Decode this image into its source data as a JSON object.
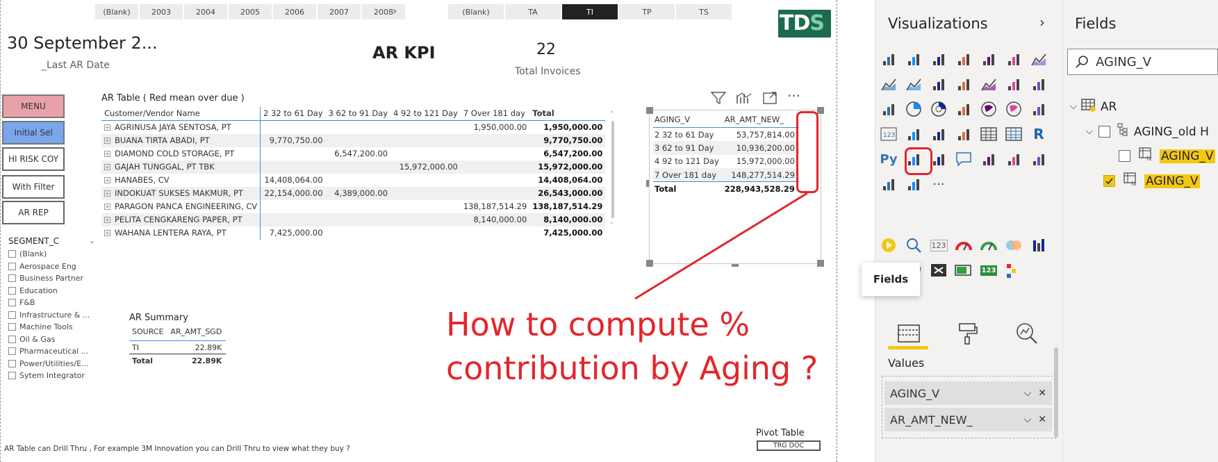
{
  "year_slicer": [
    "(Blank)",
    "2003",
    "2004",
    "2005",
    "2006",
    "2007",
    "2008"
  ],
  "segment_chips": [
    {
      "label": "(Blank)",
      "selected": false
    },
    {
      "label": "TA",
      "selected": false
    },
    {
      "label": "TI",
      "selected": true
    },
    {
      "label": "TP",
      "selected": false
    },
    {
      "label": "TS",
      "selected": false
    }
  ],
  "logo": {
    "text": "TDS"
  },
  "date_card": {
    "value": "30 September 2...",
    "label": "_Last AR Date"
  },
  "kpi_title": "AR KPI",
  "invoice_card": {
    "value": "22",
    "label": "Total Invoices"
  },
  "nav_buttons": {
    "menu": "MENU",
    "initial": "Initial Sel",
    "hi_risk": "HI RISK COY",
    "with_filter": "With Filter",
    "ar_rep": "AR REP"
  },
  "segment_slicer": {
    "title": "SEGMENT_C",
    "items": [
      "(Blank)",
      "Aerospace Eng",
      "Business Partner",
      "Education",
      "F&B",
      "Infrastructure & ...",
      "Machine Tools",
      "Oil & Gas",
      "Pharmaceutical ...",
      "Power/Utilities/E...",
      "Sytem Integrator"
    ]
  },
  "ar_table": {
    "title": "AR Table ( Red mean over due )",
    "columns": [
      "Customer/Vendor Name",
      "2 32 to 61 Day",
      "3 62 to 91 Day",
      "4 92 to 121 Day",
      "7 Over 181 day",
      "Total"
    ],
    "rows": [
      [
        "AGRINUSA JAYA SENTOSA, PT",
        "",
        "",
        "",
        "1,950,000.00",
        "1,950,000.00"
      ],
      [
        "BUANA TIRTA ABADI, PT",
        "9,770,750.00",
        "",
        "",
        "",
        "9,770,750.00"
      ],
      [
        "DIAMOND COLD STORAGE, PT",
        "",
        "6,547,200.00",
        "",
        "",
        "6,547,200.00"
      ],
      [
        "GAJAH TUNGGAL, PT TBK",
        "",
        "",
        "15,972,000.00",
        "",
        "15,972,000.00"
      ],
      [
        "HANABES, CV",
        "14,408,064.00",
        "",
        "",
        "",
        "14,408,064.00"
      ],
      [
        "INDOKUAT SUKSES MAKMUR, PT",
        "22,154,000.00",
        "4,389,000.00",
        "",
        "",
        "26,543,000.00"
      ],
      [
        "PARAGON PANCA ENGINEERING, CV",
        "",
        "",
        "",
        "138,187,514.29",
        "138,187,514.29"
      ],
      [
        "PELITA CENGKARENG PAPER, PT",
        "",
        "",
        "",
        "8,140,000.00",
        "8,140,000.00"
      ],
      [
        "WAHANA LENTERA RAYA, PT",
        "7,425,000.00",
        "",
        "",
        "",
        "7,425,000.00"
      ]
    ]
  },
  "aging_table": {
    "columns": [
      "AGING_V",
      "AR_AMT_NEW_"
    ],
    "rows": [
      [
        "2 32 to 61 Day",
        "53,757,814.00"
      ],
      [
        "3 62 to 91 Day",
        "10,936,200.00"
      ],
      [
        "4 92 to 121 Day",
        "15,972,000.00"
      ],
      [
        "7 Over 181 day",
        "148,277,514.29"
      ]
    ],
    "total": [
      "Total",
      "228,943,528.29"
    ]
  },
  "ar_summary": {
    "title": "AR Summary",
    "columns": [
      "SOURCE",
      "AR_AMT_SGD"
    ],
    "rows": [
      [
        "TI",
        "22.89K"
      ]
    ],
    "total": [
      "Total",
      "22.89K"
    ]
  },
  "annotation": {
    "line1": "How to compute %",
    "line2": "contribution by Aging ?"
  },
  "footer_note": "AR Table can Drill Thru , For example 3M Innovation you can Drill Thru to view what they buy ?",
  "pivot": {
    "label": "Pivot Table",
    "button": "TRG DOC"
  },
  "visualizations_pane": {
    "title": "Visualizations",
    "tooltip": "Fields",
    "values_label": "Values",
    "value_fields": [
      "AGING_V",
      "AR_AMT_NEW_"
    ],
    "r_icon": "R",
    "py_icon": "Py",
    "badge_123": "123"
  },
  "fields_pane": {
    "title": "Fields",
    "search_value": "AGING_V",
    "tree": {
      "table": "AR",
      "hierarchy": "AGING_old H",
      "hier_field": "AGING_V",
      "field": "AGING_V"
    }
  },
  "colors": {
    "accent_red": "#e2262b",
    "highlight_yellow": "#f2c811",
    "pbi_blue": "#3e8ee0"
  }
}
